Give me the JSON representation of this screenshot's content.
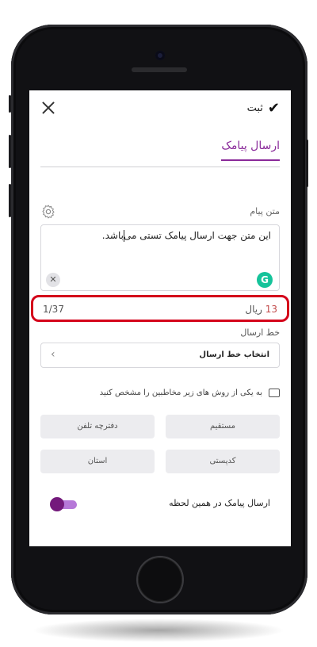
{
  "header": {
    "save_label": "ثبت",
    "check_icon": "✔"
  },
  "tabs": {
    "active": "ارسال پیامک"
  },
  "message": {
    "label": "متن پیام",
    "text": "این متن جهت ارسال پیامک تستی می‌باشد.",
    "clear_icon": "✕",
    "grammarly_icon": "G"
  },
  "counter": {
    "count": "1/37",
    "price_value": "13",
    "price_unit": "ریال"
  },
  "send_line": {
    "label": "خط ارسال",
    "placeholder": "انتخاب خط ارسال",
    "chevron": "‹"
  },
  "audience": {
    "prompt": "به یکی از روش های زیر مخاطبین را مشخص کنید",
    "options": [
      "مستقیم",
      "دفترچه تلفن",
      "کدپستی",
      "استان"
    ]
  },
  "instant": {
    "label": "ارسال پیامک در همین لحظه",
    "enabled": true
  },
  "colors": {
    "accent": "#8a2a9a",
    "highlight_border": "#d4001a",
    "toggle_knob": "#741a7c"
  }
}
